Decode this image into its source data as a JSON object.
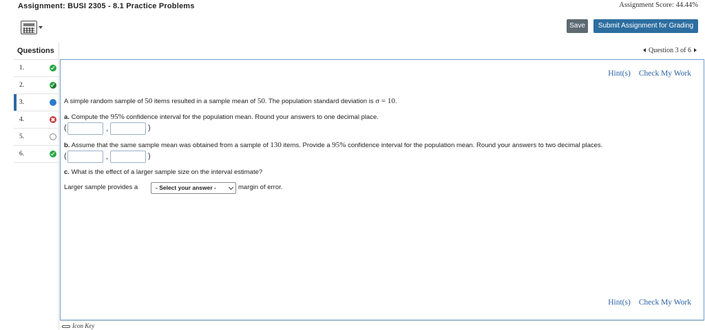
{
  "header": {
    "title": "Assignment: BUSI 2305 - 8.1 Practice Problems",
    "score": "Assignment Score: 44.44%",
    "calculator_icon": "calculator-icon",
    "save_label": "Save",
    "submit_label": "Submit Assignment for Grading"
  },
  "sidebar": {
    "heading": "Questions",
    "items": [
      {
        "num": "1.",
        "status": "complete"
      },
      {
        "num": "2.",
        "status": "partial"
      },
      {
        "num": "3.",
        "status": "current"
      },
      {
        "num": "4.",
        "status": "incorrect"
      },
      {
        "num": "5.",
        "status": "unanswered"
      },
      {
        "num": "6.",
        "status": "complete"
      }
    ]
  },
  "nav": {
    "label": "Question 3 of 6"
  },
  "links": {
    "hint": "Hint(s)",
    "check": "Check My Work"
  },
  "question": {
    "intro_pre": "A simple random sample of ",
    "n1": "50",
    "intro_mid": " items resulted in a sample mean of ",
    "mean": "50",
    "intro_mid2": ". The population standard deviation is ",
    "sigma": "σ = 10",
    "intro_end": ".",
    "a_label": "a.",
    "a_pre": " Compute the ",
    "a_pct": "95%",
    "a_post": " confidence interval for the population mean. Round your answers to one decimal place.",
    "b_label": "b.",
    "b_pre": " Assume that the same sample mean was obtained from a sample of ",
    "b_n": "130",
    "b_mid": " items. Provide a ",
    "b_pct": "95%",
    "b_post": " confidence interval for the population mean. Round your answers to two decimal places.",
    "c_label": "c.",
    "c_text": " What is the effect of a larger sample size on the interval estimate?",
    "c_pre": "Larger sample provides a",
    "c_select": "- Select your answer -",
    "c_post": "margin of error."
  },
  "answers": {
    "a_low": "",
    "a_high": "",
    "b_low": "",
    "b_high": "",
    "open_paren": "(",
    "comma": ",",
    "close_paren": ")"
  },
  "footer": {
    "icon_key": "Icon Key"
  },
  "colors": {
    "accent": "#2d6ea0",
    "link": "#2b62a4",
    "complete": "#28a745",
    "incorrect": "#c8383c",
    "current": "#2b7bd1"
  }
}
